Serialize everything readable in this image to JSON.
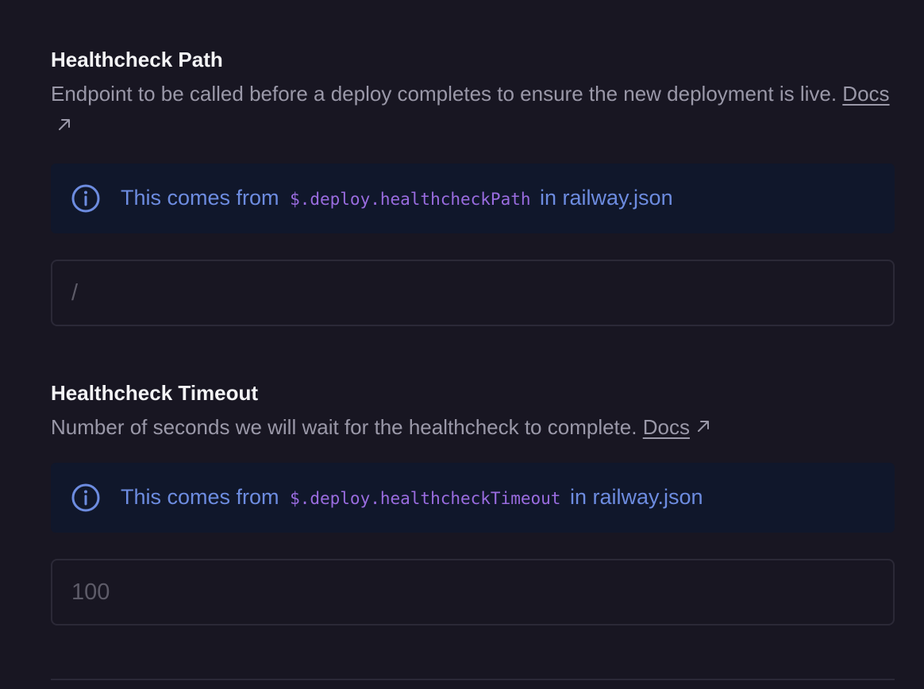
{
  "sections": [
    {
      "title": "Healthcheck Path",
      "description": "Endpoint to be called before a deploy completes to ensure the new deployment is live.",
      "docs_label": "Docs",
      "info": {
        "prefix": "This comes from",
        "code": "$.deploy.healthcheckPath",
        "suffix": "in railway.json"
      },
      "input": {
        "value": "",
        "placeholder": "/"
      }
    },
    {
      "title": "Healthcheck Timeout",
      "description": "Number of seconds we will wait for the healthcheck to complete.",
      "docs_label": "Docs",
      "info": {
        "prefix": "This comes from",
        "code": "$.deploy.healthcheckTimeout",
        "suffix": "in railway.json"
      },
      "input": {
        "value": "",
        "placeholder": "100"
      }
    }
  ],
  "icons": {
    "info": "info-circle-icon",
    "external_link": "arrow-up-right-icon"
  },
  "colors": {
    "background": "#181622",
    "banner_background": "#10172b",
    "accent_text": "#6d8ce0",
    "code_text": "#9a6ce0",
    "muted_text": "#9a98a8",
    "title_text": "#f4f4f6"
  }
}
